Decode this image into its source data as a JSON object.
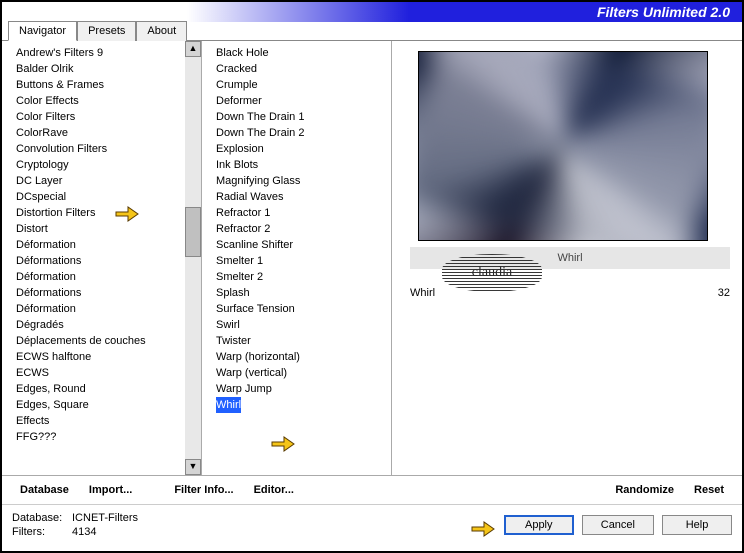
{
  "title": "Filters Unlimited 2.0",
  "tabs": [
    "Navigator",
    "Presets",
    "About"
  ],
  "active_tab": 0,
  "categories": [
    "Andrew's Filters 9",
    "Balder Olrik",
    "Buttons & Frames",
    "Color Effects",
    "Color Filters",
    "ColorRave",
    "Convolution Filters",
    "Cryptology",
    "DC Layer",
    "DCspecial",
    "Distortion Filters",
    "Distort",
    "Déformation",
    "Déformations",
    "Déformation",
    "Déformations",
    "Déformation",
    "Dégradés",
    "Déplacements de couches",
    "ECWS halftone",
    "ECWS",
    "Edges, Round",
    "Edges, Square",
    "Effects",
    "FFG???"
  ],
  "selected_category_index": 10,
  "filters": [
    "Black Hole",
    "Cracked",
    "Crumple",
    "Deformer",
    "Down The Drain 1",
    "Down The Drain 2",
    "Explosion",
    "Ink Blots",
    "Magnifying Glass",
    "Radial Waves",
    "Refractor 1",
    "Refractor 2",
    "Scanline Shifter",
    "Smelter 1",
    "Smelter 2",
    "Splash",
    "Surface Tension",
    "Swirl",
    "Twister",
    "Warp (horizontal)",
    "Warp (vertical)",
    "Warp Jump",
    "Whirl"
  ],
  "selected_filter_index": 22,
  "filter_label": "Whirl",
  "params": [
    {
      "name": "Whirl",
      "value": "32"
    }
  ],
  "toolbar": {
    "database": "Database",
    "import": "Import...",
    "filter_info": "Filter Info...",
    "editor": "Editor...",
    "randomize": "Randomize",
    "reset": "Reset"
  },
  "footer": {
    "db_key": "Database:",
    "db_val": "ICNET-Filters",
    "filters_key": "Filters:",
    "filters_val": "4134"
  },
  "buttons": {
    "apply": "Apply",
    "cancel": "Cancel",
    "help": "Help"
  },
  "watermark": "claudia"
}
